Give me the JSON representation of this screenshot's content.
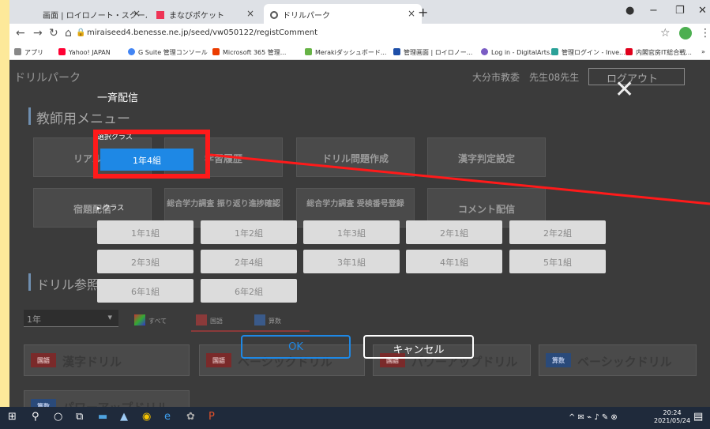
{
  "browser": {
    "tabs": [
      {
        "title": "画面 | ロイロノート・スクール"
      },
      {
        "title": "まなびポケット"
      },
      {
        "title": "ドリルパーク"
      }
    ],
    "url": "miraiseed4.benesse.ne.jp/seed/vw050122/registComment",
    "bookmarks": [
      {
        "label": "アプリ",
        "color": "#888888"
      },
      {
        "label": "Yahoo! JAPAN",
        "color": "#ff0033"
      },
      {
        "label": "G Suite 管理コンソール",
        "color": "#4285f4"
      },
      {
        "label": "Microsoft 365 管理...",
        "color": "#eb3c00"
      },
      {
        "label": "Merakiダッシュボード...",
        "color": "#67b346"
      },
      {
        "label": "管理画面 | ロイロノー...",
        "color": "#1e4fa8"
      },
      {
        "label": "Log in - DigitalArts...",
        "color": "#7a5cc4"
      },
      {
        "label": "管理ログイン - Inve...",
        "color": "#2aa198"
      },
      {
        "label": "内閣官房IT総合戦...",
        "color": "#e0001b"
      }
    ]
  },
  "app": {
    "title": "ドリルパーク",
    "user": "大分市教委　先生08先生",
    "logout": "ログアウト",
    "menu_title": "教師用メニュー",
    "menu_tiles": [
      "リアルタ",
      "学習履歴",
      "ドリル問題作成",
      "漢字判定設定",
      "宿題配信",
      "総合学力調査 振り返り進捗確認",
      "総合学力調査 受検番号登録",
      "コメント配信"
    ],
    "drill_title": "ドリル参照",
    "grade": "1年",
    "filters": [
      "すべて",
      "国語",
      "算数"
    ],
    "drills": [
      {
        "tag": "国語",
        "label": "漢字ドリル"
      },
      {
        "tag": "国語",
        "label": "ベーシックドリル"
      },
      {
        "tag": "国語",
        "label": "パワーアップドリル"
      },
      {
        "tag": "算数",
        "label": "ベーシックドリル"
      },
      {
        "tag": "算数",
        "label": "パワーアップドリル"
      }
    ]
  },
  "modal": {
    "title": "一斉配信",
    "close_icon": "close-icon",
    "selected_label": "選択クラス",
    "selected_classes": [
      "1年4組"
    ],
    "class_label": "クラス",
    "classes": [
      "1年1組",
      "1年2組",
      "1年3組",
      "2年1組",
      "2年2組",
      "2年3組",
      "2年4組",
      "3年1組",
      "4年1組",
      "5年1組",
      "6年1組",
      "6年2組"
    ],
    "ok": "OK",
    "cancel": "キャンセル",
    "highlight_color": "#ff1a1a"
  },
  "taskbar": {
    "time": "20:24",
    "date": "2021/05/24"
  }
}
